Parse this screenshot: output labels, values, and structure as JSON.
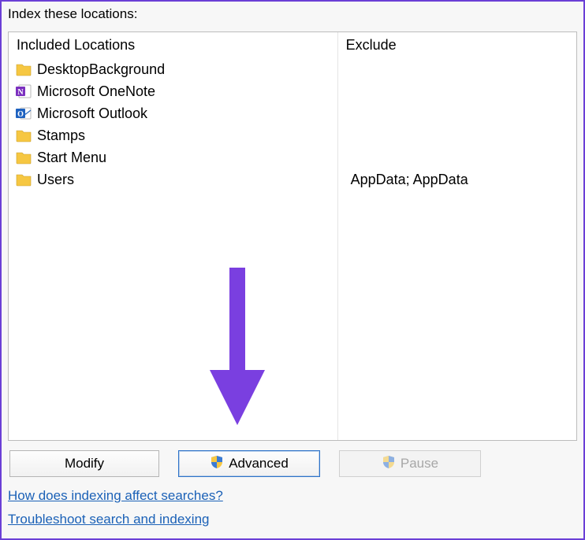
{
  "header": {
    "title": "Index these locations:"
  },
  "columns": {
    "included_header": "Included Locations",
    "exclude_header": "Exclude"
  },
  "included": [
    {
      "icon": "folder",
      "label": "DesktopBackground",
      "exclude": ""
    },
    {
      "icon": "onenote",
      "label": "Microsoft OneNote",
      "exclude": ""
    },
    {
      "icon": "outlook",
      "label": "Microsoft Outlook",
      "exclude": ""
    },
    {
      "icon": "folder",
      "label": "Stamps",
      "exclude": ""
    },
    {
      "icon": "folder",
      "label": "Start Menu",
      "exclude": ""
    },
    {
      "icon": "folder",
      "label": "Users",
      "exclude": "AppData; AppData"
    }
  ],
  "buttons": {
    "modify": "Modify",
    "advanced": "Advanced",
    "pause": "Pause"
  },
  "links": {
    "help": "How does indexing affect searches?",
    "troubleshoot": "Troubleshoot search and indexing"
  }
}
